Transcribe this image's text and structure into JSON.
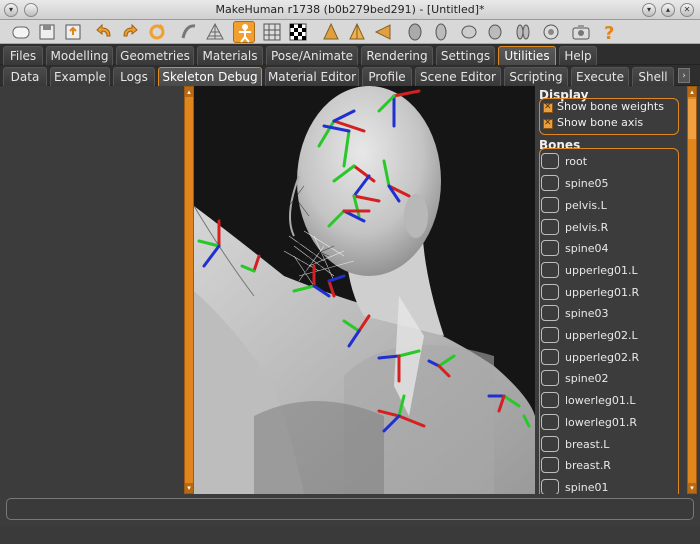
{
  "window": {
    "title": "MakeHuman r1738 (b0b279bed291) - [Untitled]*"
  },
  "colors": {
    "accent": "#e0861c",
    "panel": "#3c3c3c",
    "bone_red": "#d42020",
    "bone_green": "#28c828",
    "bone_blue": "#2030d0"
  },
  "toolbar": {
    "icons": [
      "new-file-icon",
      "save-icon",
      "export-icon",
      "undo-icon",
      "redo-icon",
      "reset-icon",
      "smooth-icon",
      "wireframe-icon",
      "skeleton-icon",
      "grid-icon",
      "checker-icon",
      "front-view-icon",
      "back-view-icon",
      "left-view-icon",
      "right-view-icon",
      "top-view-icon",
      "bottom-view-icon",
      "reset-camera-icon",
      "screenshot-icon",
      "help-icon"
    ]
  },
  "main_tabs": [
    "Files",
    "Modelling",
    "Geometries",
    "Materials",
    "Pose/Animate",
    "Rendering",
    "Settings",
    "Utilities",
    "Help"
  ],
  "main_tab_selected": "Utilities",
  "sub_tabs": [
    "Data",
    "Example",
    "Logs",
    "Skeleton Debug",
    "Material Editor",
    "Profile",
    "Scene Editor",
    "Scripting",
    "Execute",
    "Shell"
  ],
  "sub_tab_selected": "Skeleton Debug",
  "display": {
    "title": "Display",
    "options": [
      {
        "label": "Show bone weights",
        "checked": true
      },
      {
        "label": "Show bone axis",
        "checked": true
      }
    ]
  },
  "bones": {
    "title": "Bones",
    "items": [
      "root",
      "spine05",
      "pelvis.L",
      "pelvis.R",
      "spine04",
      "upperleg01.L",
      "upperleg01.R",
      "spine03",
      "upperleg02.L",
      "upperleg02.R",
      "spine02",
      "lowerleg01.L",
      "lowerleg01.R",
      "breast.L",
      "breast.R",
      "spine01"
    ]
  },
  "status": {
    "message": ""
  }
}
